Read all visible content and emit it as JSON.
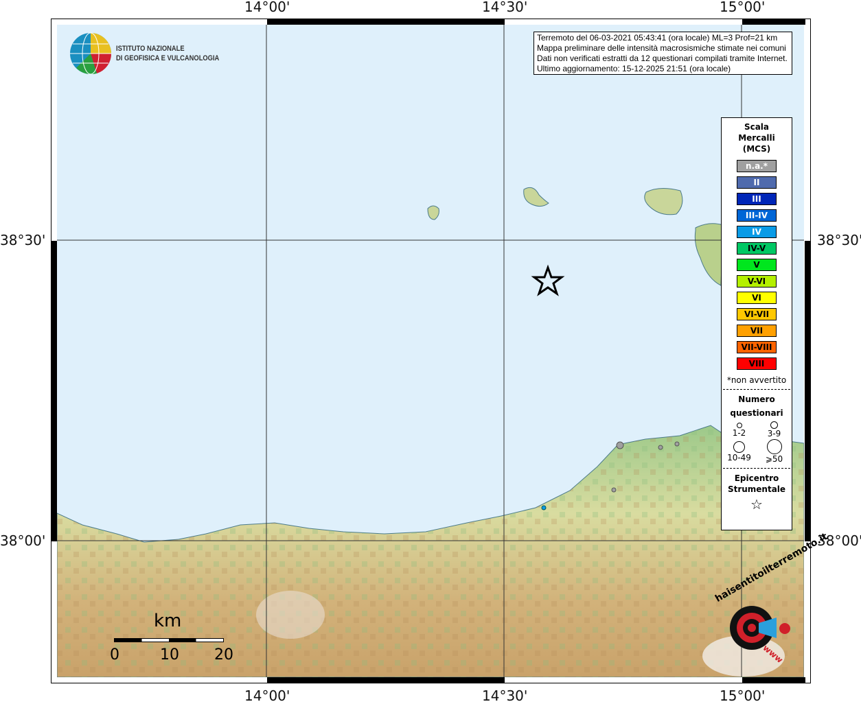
{
  "axes": {
    "top": [
      "14°00'",
      "14°30'",
      "15°00'"
    ],
    "bottom": [
      "14°00'",
      "14°30'",
      "15°00'"
    ],
    "left": [
      "38°30'",
      "38°00'"
    ],
    "right": [
      "38°30'",
      "38°00'"
    ]
  },
  "institute": {
    "line1": "ISTITUTO NAZIONALE",
    "line2": "DI GEOFISICA E VULCANOLOGIA"
  },
  "info": [
    "Terremoto del 06-03-2021 05:43:41 (ora locale) ML=3 Prof=21 km",
    "Mappa preliminare delle intensità macrosismiche stimate nei comuni",
    "Dati non verificati estratti da 12 questionari compilati tramite Internet.",
    "Ultimo aggiornamento: 15-12-2025 21:51 (ora locale)"
  ],
  "legend": {
    "title": "Scala Mercalli (MCS)",
    "classes": [
      {
        "label": "n.a.*",
        "color": "#a0a0a0"
      },
      {
        "label": "II",
        "color": "#4f6aad"
      },
      {
        "label": "III",
        "color": "#0026b8"
      },
      {
        "label": "III-IV",
        "color": "#0066d6"
      },
      {
        "label": "IV",
        "color": "#0a9be6"
      },
      {
        "label": "IV-V",
        "color": "#00c864"
      },
      {
        "label": "V",
        "color": "#00e61e"
      },
      {
        "label": "V-VI",
        "color": "#b4f000"
      },
      {
        "label": "VI",
        "color": "#ffff00"
      },
      {
        "label": "VI-VII",
        "color": "#ffc800"
      },
      {
        "label": "VII",
        "color": "#ffa000"
      },
      {
        "label": "VII-VIII",
        "color": "#ff6400"
      },
      {
        "label": "VIII",
        "color": "#ff0000"
      }
    ],
    "note": "*non avvertito",
    "count_title1": "Numero",
    "count_title2": "questionari",
    "counts": [
      "1-2",
      "3-9",
      "10-49",
      "⩾50"
    ],
    "epi_title1": "Epicentro",
    "epi_title2": "Strumentale"
  },
  "scale": {
    "unit": "km",
    "ticks": [
      "0",
      "10",
      "20"
    ]
  },
  "badge": {
    "text": "haisentitoilterremoto.it",
    "www": "www"
  }
}
